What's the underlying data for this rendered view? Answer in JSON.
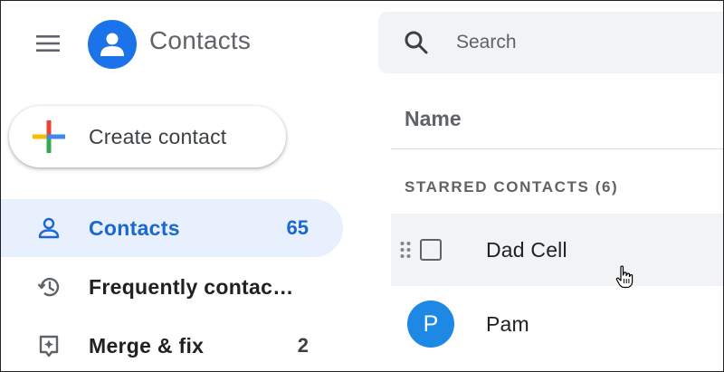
{
  "app": {
    "title": "Contacts",
    "icons": {
      "menu": "hamburger-menu-icon",
      "logo": "contacts-person-icon"
    }
  },
  "search": {
    "placeholder": "Search",
    "value": "",
    "icon": "search-icon"
  },
  "create_button": {
    "label": "Create contact",
    "icon": "multicolor-plus-icon"
  },
  "sidebar": {
    "items": [
      {
        "label": "Contacts",
        "count": "65",
        "icon": "person-icon",
        "active": true
      },
      {
        "label": "Frequently contac…",
        "count": "",
        "icon": "history-icon",
        "active": false
      },
      {
        "label": "Merge & fix",
        "count": "2",
        "icon": "merge-fix-icon",
        "active": false
      }
    ]
  },
  "list": {
    "column_header": "Name",
    "section_label": "STARRED CONTACTS (6)",
    "rows": [
      {
        "name": "Dad Cell",
        "hovered": true
      },
      {
        "name": "Pam",
        "avatar_letter": "P",
        "avatar_color": "#1e88e5"
      }
    ]
  },
  "colors": {
    "accent": "#1a73e8",
    "active_text": "#1967d2",
    "active_bg": "#e8f0fe",
    "search_bg": "#f1f3f4"
  }
}
